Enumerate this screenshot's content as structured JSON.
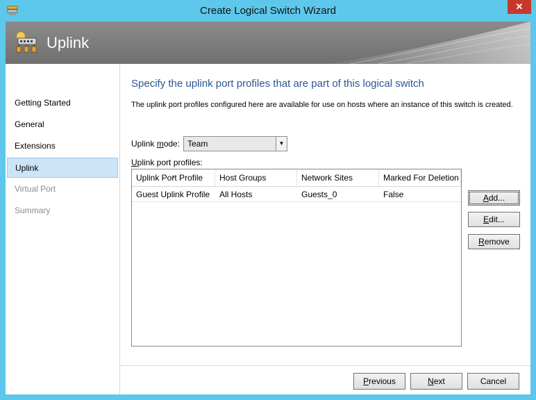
{
  "window": {
    "title": "Create Logical Switch Wizard",
    "close_glyph": "✕"
  },
  "banner": {
    "title": "Uplink",
    "icon": "network-switch-icon"
  },
  "nav": {
    "items": [
      {
        "label": "Getting Started",
        "state": "normal"
      },
      {
        "label": "General",
        "state": "normal"
      },
      {
        "label": "Extensions",
        "state": "normal"
      },
      {
        "label": "Uplink",
        "state": "active"
      },
      {
        "label": "Virtual Port",
        "state": "disabled"
      },
      {
        "label": "Summary",
        "state": "disabled"
      }
    ]
  },
  "page": {
    "heading": "Specify the uplink port profiles that are part of this logical switch",
    "description": "The uplink port profiles configured here are available for use on hosts where an instance of this switch is created."
  },
  "uplink_mode": {
    "label_pre": "Uplink ",
    "label_key": "m",
    "label_post": "ode:",
    "value": "Team"
  },
  "profiles": {
    "label_key": "U",
    "label_rest": "plink port profiles:",
    "columns": [
      "Uplink Port Profile",
      "Host Groups",
      "Network Sites",
      "Marked For Deletion"
    ],
    "rows": [
      [
        "Guest Uplink Profile",
        "All Hosts",
        "Guests_0",
        "False"
      ]
    ]
  },
  "buttons": {
    "add": {
      "key": "A",
      "rest": "dd..."
    },
    "edit": {
      "key": "E",
      "rest": "dit..."
    },
    "remove": {
      "key": "R",
      "rest": "emove"
    },
    "previous": {
      "key": "P",
      "rest": "revious"
    },
    "next": {
      "key": "N",
      "rest": "ext"
    },
    "cancel": {
      "label": "Cancel"
    }
  },
  "colors": {
    "accent": "#2a5693",
    "frame": "#5ec7ec",
    "close": "#c7382b",
    "selected_nav": "#cde4f7"
  }
}
